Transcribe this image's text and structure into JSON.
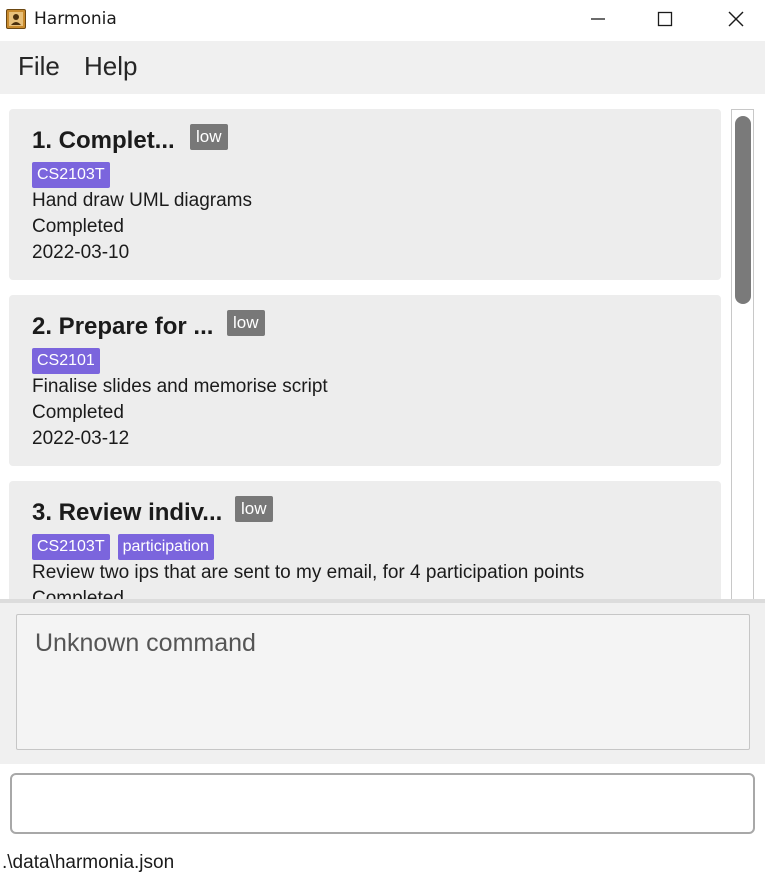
{
  "window": {
    "title": "Harmonia"
  },
  "menu": {
    "file": "File",
    "help": "Help"
  },
  "tasks": [
    {
      "index_title": "1.  Complet...",
      "priority": "low",
      "tags": [
        "CS2103T"
      ],
      "description": "Hand draw UML diagrams",
      "status": "Completed",
      "date": "2022-03-10"
    },
    {
      "index_title": "2.  Prepare for ...",
      "priority": "low",
      "tags": [
        "CS2101"
      ],
      "description": "Finalise slides and memorise script",
      "status": "Completed",
      "date": "2022-03-12"
    },
    {
      "index_title": "3.  Review indiv...",
      "priority": "low",
      "tags": [
        "CS2103T",
        "participation"
      ],
      "description": "Review two ips that are sent to my email, for 4 participation points",
      "status": "Completed",
      "date": ""
    }
  ],
  "result": {
    "message": "Unknown command"
  },
  "command": {
    "value": "",
    "placeholder": ""
  },
  "status_bar": {
    "path": ".\\data\\harmonia.json"
  },
  "colors": {
    "tag": "#7b65dd",
    "priority_badge": "#787878",
    "card_background": "#ededed"
  },
  "icons": {
    "app": "contact-book-icon",
    "minimize": "minimize-icon",
    "maximize": "maximize-icon",
    "close": "close-icon"
  }
}
